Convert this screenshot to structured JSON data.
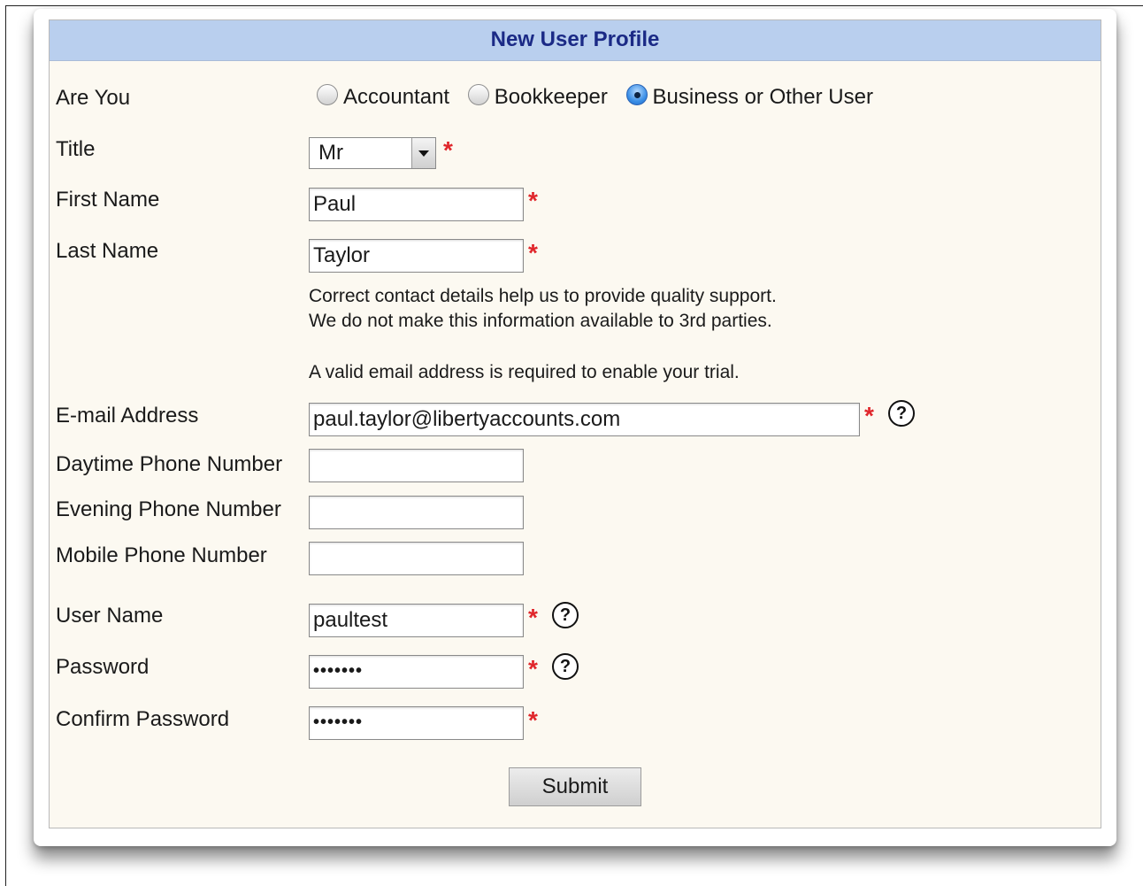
{
  "form": {
    "title": "New User Profile",
    "role": {
      "label": "Are You",
      "options": [
        "Accountant",
        "Bookkeeper",
        "Business or Other User"
      ],
      "selected": "Business or Other User"
    },
    "title_field": {
      "label": "Title",
      "value": "Mr"
    },
    "first_name": {
      "label": "First Name",
      "value": "Paul"
    },
    "last_name": {
      "label": "Last Name",
      "value": "Taylor"
    },
    "notes": {
      "line1": "Correct contact details help us to provide quality support.",
      "line2": "We do not make this information available to 3rd parties.",
      "line3": "A valid email address is required to enable your trial."
    },
    "email": {
      "label": "E-mail Address",
      "value": "paul.taylor@libertyaccounts.com"
    },
    "daytime_phone": {
      "label": "Daytime Phone Number",
      "value": ""
    },
    "evening_phone": {
      "label": "Evening Phone Number",
      "value": ""
    },
    "mobile_phone": {
      "label": "Mobile Phone Number",
      "value": ""
    },
    "username": {
      "label": "User Name",
      "value": "paultest"
    },
    "password": {
      "label": "Password",
      "value": "•••••••"
    },
    "confirm_password": {
      "label": "Confirm Password",
      "value": "•••••••"
    },
    "submit_label": "Submit",
    "required_marker": "*",
    "help_marker": "?"
  },
  "colors": {
    "header_bg": "#b9cfee",
    "header_text": "#1b2a86",
    "panel_bg": "#fcf9f1",
    "required": "#e0262b"
  },
  "icons": {
    "required": "asterisk-icon",
    "help": "question-mark-circle-icon",
    "dropdown": "chevron-down-icon"
  }
}
